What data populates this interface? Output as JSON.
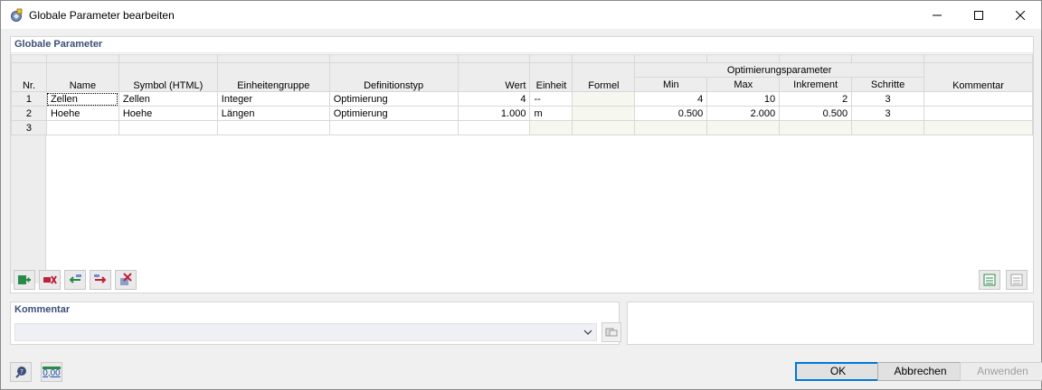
{
  "window": {
    "title": "Globale Parameter bearbeiten"
  },
  "main_panel": {
    "title": "Globale Parameter"
  },
  "table": {
    "group_header": "Optimierungsparameter",
    "columns": {
      "nr": "Nr.",
      "name": "Name",
      "symbol": "Symbol (HTML)",
      "unit_group": "Einheitengruppe",
      "def_type": "Definitionstyp",
      "value": "Wert",
      "unit": "Einheit",
      "formula": "Formel",
      "min": "Min",
      "max": "Max",
      "increment": "Inkrement",
      "steps": "Schritte",
      "comment": "Kommentar"
    },
    "rows": [
      {
        "nr": "1",
        "name": "Zellen",
        "symbol": "Zellen",
        "unit_group": "Integer",
        "def_type": "Optimierung",
        "value": "4",
        "unit": "--",
        "formula": "",
        "min": "4",
        "max": "10",
        "increment": "2",
        "steps": "3",
        "comment": ""
      },
      {
        "nr": "2",
        "name": "Hoehe",
        "symbol": "Hoehe",
        "unit_group": "Längen",
        "def_type": "Optimierung",
        "value": "1.000",
        "unit": "m",
        "formula": "",
        "min": "0.500",
        "max": "2.000",
        "increment": "0.500",
        "steps": "3",
        "comment": ""
      },
      {
        "nr": "3",
        "name": "",
        "symbol": "",
        "unit_group": "",
        "def_type": "",
        "value": "",
        "unit": "",
        "formula": "",
        "min": "",
        "max": "",
        "increment": "",
        "steps": "",
        "comment": ""
      }
    ]
  },
  "comment_panel": {
    "title": "Kommentar",
    "value": ""
  },
  "buttons": {
    "ok": "OK",
    "cancel": "Abbrechen",
    "apply": "Anwenden"
  },
  "units_icon_text": "0,00",
  "colors": {
    "header_text": "#3c4e78",
    "ok_border": "#0078d7",
    "tint_cell": "#f6f8ef"
  }
}
